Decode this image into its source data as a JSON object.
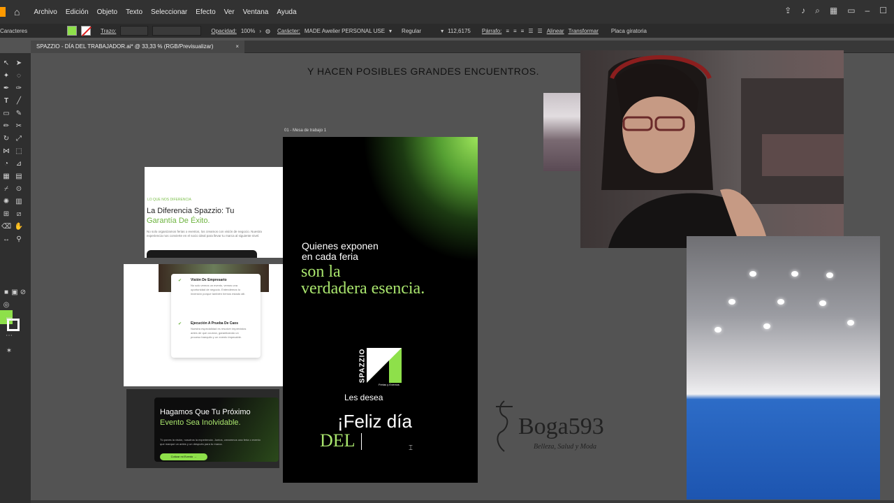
{
  "menubar": {
    "items": [
      "Archivo",
      "Edición",
      "Objeto",
      "Texto",
      "Seleccionar",
      "Efecto",
      "Ver",
      "Ventana",
      "Ayuda"
    ]
  },
  "control_bar": {
    "panel_label": "Caracteres",
    "stroke_label": "Trazo:",
    "opacity_label": "Opacidad:",
    "opacity_value": "100%",
    "character_label": "Carácter:",
    "font_name": "MADE Awelier PERSONAL USE",
    "font_style": "Regular",
    "font_size": "112,6175",
    "paragraph_label": "Párrafo:",
    "align_label": "Alinear",
    "transform_label": "Transformar",
    "rotate_label": "Placa giratoria"
  },
  "document_tab": {
    "title": "SPAZZIO - DÍA DEL TRABAJADOR.ai* @ 33,33 % (RGB/Previsualizar)",
    "close": "×"
  },
  "canvas": {
    "headline": "Y HACEN POSIBLES GRANDES ENCUENTROS.",
    "artboard_label": "01 - Mesa de trabajo 1"
  },
  "artboard": {
    "line1": "Quienes exponen",
    "line2": "en cada feria",
    "green1": "son la",
    "green2": "verdadera esencia.",
    "logo_word": "SPAZZIO",
    "logo_sub": "Ferias y Eventos",
    "les_desea": "Les desea",
    "feliz": "¡Feliz día",
    "del": "DEL"
  },
  "shot1": {
    "kicker": "LO QUE NOS DIFERENCIA",
    "title_a": "La Diferencia Spazzio: Tu",
    "title_b": "Garantía De Éxito.",
    "body": "No solo organizamos ferias o eventos, los creamos con visión de negocio. Nuestra experiencia nos convierte en el socio ideal para llevar tu marca al siguiente nivel."
  },
  "shot2": {
    "item1_title": "Visión De Empresario",
    "item1_body": "No solo vemos un evento, vemos una oportunidad de negocio. Entendemos tu inversión porque también hemos estado allí.",
    "item2_title": "Ejecución A Prueba De Caos",
    "item2_body": "Nuestra especialidad es resolver imprevistos antes de que ocurran, garantizando un proceso tranquilo y un evento impecable."
  },
  "shot3": {
    "title_a": "Hagamos Que Tu Próximo",
    "title_b": "Evento Sea Inolvidable.",
    "body": "Tú pones la visión, nosotros la experiencia. Juntos, crearemos una feria o evento que marque un antes y un después para tu marca.",
    "button": "Cotizar mi Evento →"
  },
  "boga": {
    "name": "Boga593",
    "tagline": "Belleza, Salud y Moda"
  },
  "colors": {
    "accent_green": "#8ee04a",
    "app_bg": "#535353",
    "menubar_bg": "#323232"
  }
}
